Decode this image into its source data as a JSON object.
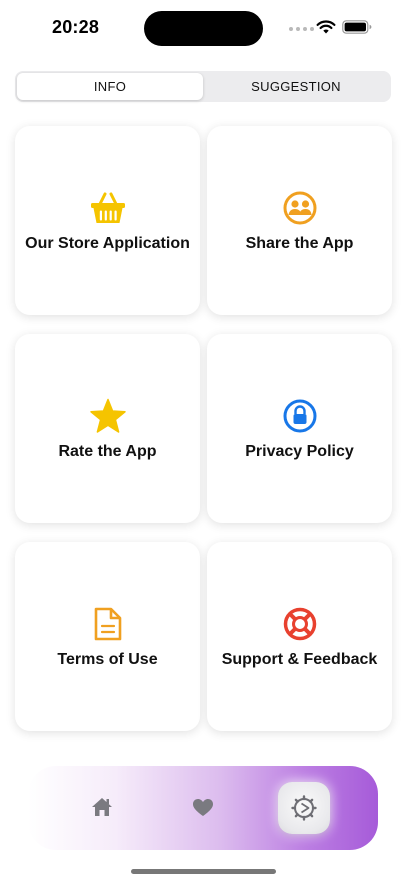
{
  "status_bar": {
    "time": "20:28",
    "icons": [
      "cellular-signal-icon",
      "wifi-icon",
      "battery-icon"
    ]
  },
  "segmented_control": {
    "tabs": [
      {
        "label": "INFO",
        "selected": true
      },
      {
        "label": "SUGGESTION",
        "selected": false
      }
    ]
  },
  "cards": [
    {
      "label": "Our Store Application",
      "icon": "basket-icon",
      "color": "#F5C400"
    },
    {
      "label": "Share the App",
      "icon": "people-circle-icon",
      "color": "#F0A020"
    },
    {
      "label": "Rate the App",
      "icon": "star-icon",
      "color": "#F5C400"
    },
    {
      "label": "Privacy Policy",
      "icon": "lock-circle-icon",
      "color": "#1877E8"
    },
    {
      "label": "Terms of Use",
      "icon": "document-icon",
      "color": "#F0A020"
    },
    {
      "label": "Support & Feedback",
      "icon": "lifebuoy-icon",
      "color": "#E8412F"
    }
  ],
  "tab_bar": {
    "items": [
      {
        "icon": "home-icon",
        "selected": false
      },
      {
        "icon": "heart-icon",
        "selected": false
      },
      {
        "icon": "settings-gear-icon",
        "selected": true
      }
    ],
    "gradient_colors": [
      "#ffffff",
      "#dcbcee",
      "#a65bd9"
    ]
  }
}
